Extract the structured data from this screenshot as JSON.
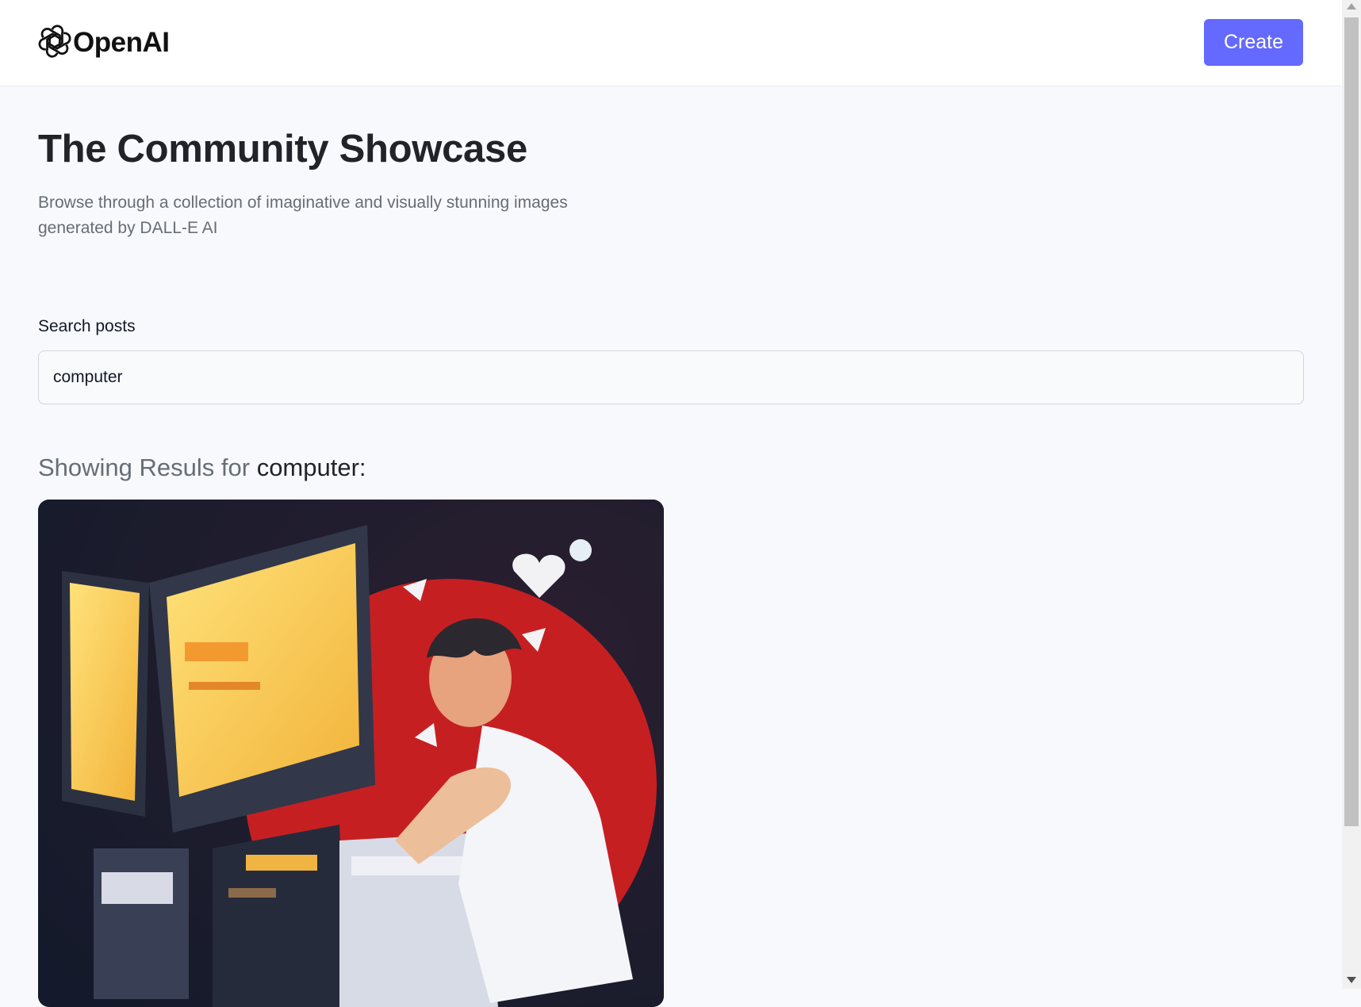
{
  "header": {
    "logo_text": "OpenAI",
    "logo_icon": "openai-logo-icon",
    "create_label": "Create"
  },
  "hero": {
    "title": "The Community Showcase",
    "subtitle": "Browse through a collection of imaginative and visually stunning images generated by DALL-E AI"
  },
  "search": {
    "label": "Search posts",
    "value": "computer"
  },
  "results": {
    "prefix": "Showing Resuls for ",
    "query": "computer",
    "suffix": ":"
  },
  "colors": {
    "accent": "#6469ff",
    "background": "#f8f9fc",
    "muted_text": "#666e75"
  }
}
